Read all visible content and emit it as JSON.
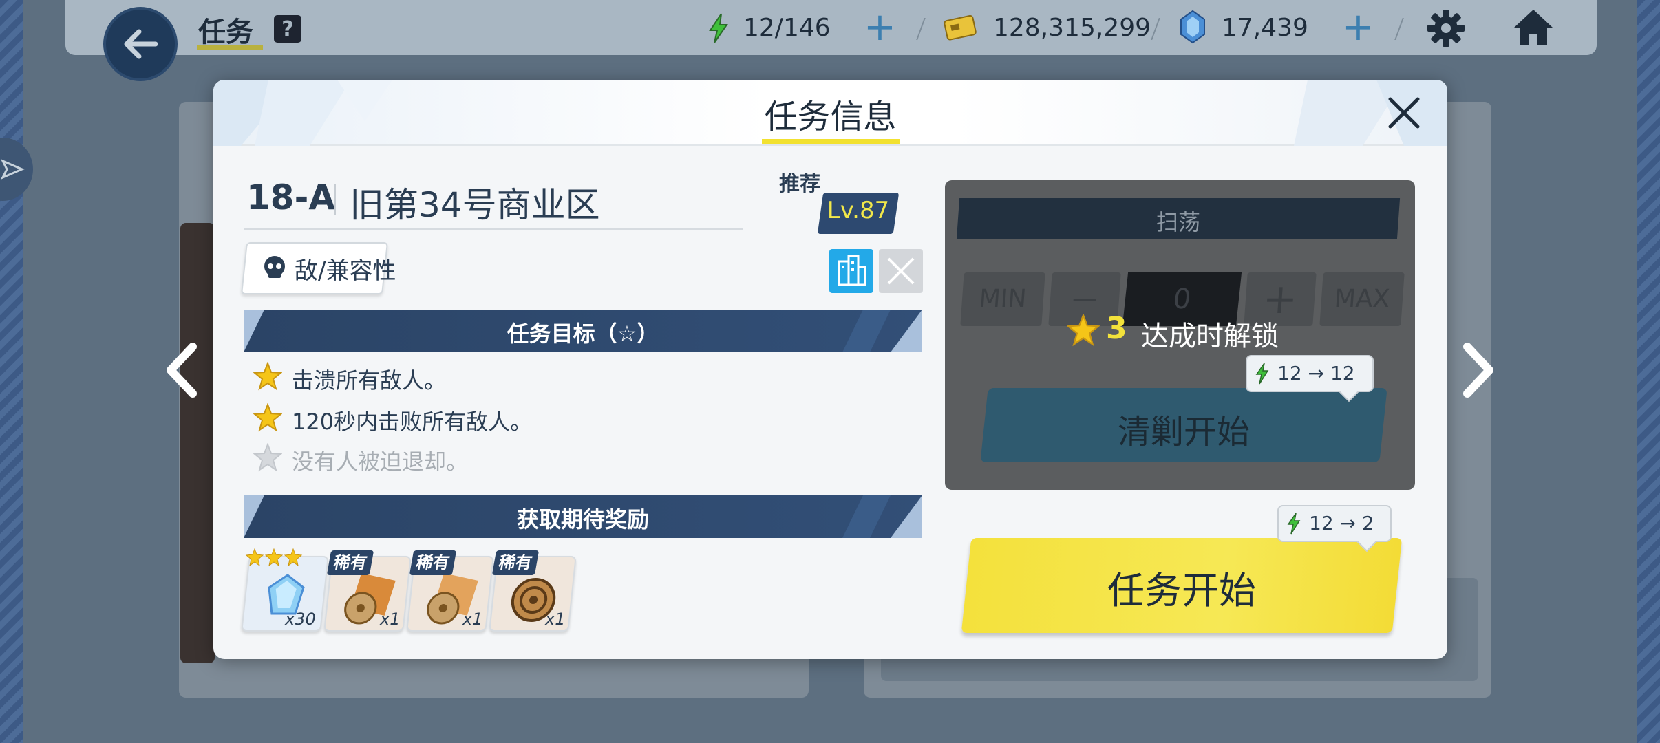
{
  "topbar": {
    "title": "任务",
    "help_label": "?",
    "energy": "12/146",
    "credits": "128,315,299",
    "gems": "17,439"
  },
  "modal": {
    "title": "任务信息",
    "stage_code": "18-A",
    "stage_name": "旧第34号商业区",
    "recommended_label": "推荐",
    "recommended_level": "Lv.87",
    "enemy_tag": "敌/兼容性",
    "objectives_header": "任务目标（☆）",
    "objectives": [
      {
        "text": "击溃所有敌人。",
        "achieved": true
      },
      {
        "text": "120秒内击败所有敌人。",
        "achieved": true
      },
      {
        "text": "没有人被迫退却。",
        "achieved": false
      }
    ],
    "rewards_header": "获取期待奖励",
    "rewards": [
      {
        "quantity": "x30",
        "tag": "",
        "stars": 3
      },
      {
        "quantity": "x1",
        "tag": "稀有"
      },
      {
        "quantity": "x1",
        "tag": "稀有"
      },
      {
        "quantity": "x1",
        "tag": "稀有"
      }
    ]
  },
  "sweep": {
    "title": "扫荡",
    "min_label": "MIN",
    "minus_label": "—",
    "count": "0",
    "plus_label": "+",
    "max_label": "MAX",
    "lock_stars": "3",
    "lock_text": "达成时解锁",
    "cost_from": "12",
    "cost_to": "12",
    "start_label": "清剿开始"
  },
  "mission_start": {
    "label": "任务开始",
    "cost_from": "12",
    "cost_to": "2"
  },
  "colors": {
    "accent_yellow": "#f4e13c",
    "navy": "#2b4466",
    "star_gold": "#f5c518",
    "energy_green": "#3fbf3a"
  }
}
